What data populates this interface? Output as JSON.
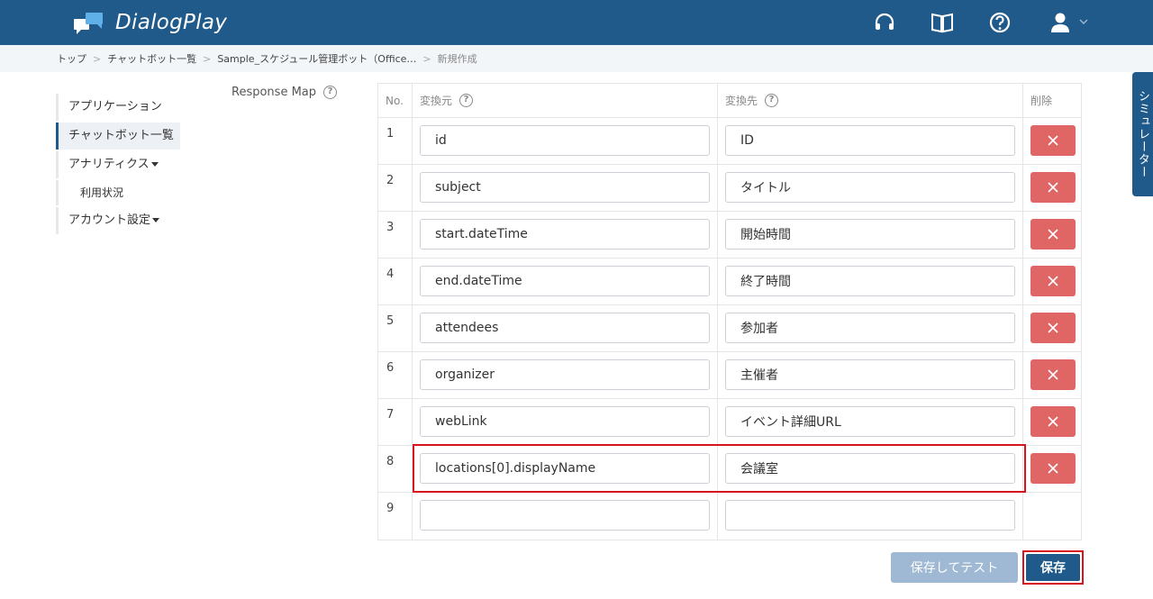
{
  "header": {
    "app_name": "DialogPlay",
    "colors": {
      "primary": "#1f5a8a",
      "danger": "#e06666",
      "highlight": "#d7141d"
    },
    "icons": [
      "headset-icon",
      "book-icon",
      "help-icon",
      "user-icon",
      "chevron-down-icon"
    ]
  },
  "breadcrumb": {
    "items": [
      "トップ",
      "チャットボット一覧",
      "Sample_スケジュール管理ボット（Office…",
      "新規作成"
    ],
    "separator": ">"
  },
  "sidebar": {
    "items": [
      "アプリケーション",
      "チャットボット一覧",
      "アナリティクス",
      "利用状況",
      "アカウント設定"
    ]
  },
  "response_map": {
    "label": "Response Map",
    "columns": {
      "no": "No.",
      "source": "変換元",
      "target": "変換先",
      "delete": "削除"
    },
    "rows": [
      {
        "no": "1",
        "source": "id",
        "target": "ID"
      },
      {
        "no": "2",
        "source": "subject",
        "target": "タイトル"
      },
      {
        "no": "3",
        "source": "start.dateTime",
        "target": "開始時間"
      },
      {
        "no": "4",
        "source": "end.dateTime",
        "target": "終了時間"
      },
      {
        "no": "5",
        "source": "attendees",
        "target": "参加者"
      },
      {
        "no": "6",
        "source": "organizer",
        "target": "主催者"
      },
      {
        "no": "7",
        "source": "webLink",
        "target": "イベント詳細URL"
      },
      {
        "no": "8",
        "source": "locations[0].displayName",
        "target": "会議室"
      },
      {
        "no": "9",
        "source": "",
        "target": ""
      }
    ]
  },
  "actions": {
    "save_and_test": "保存してテスト",
    "save": "保存"
  },
  "simulator_tab": "シミュレーター"
}
